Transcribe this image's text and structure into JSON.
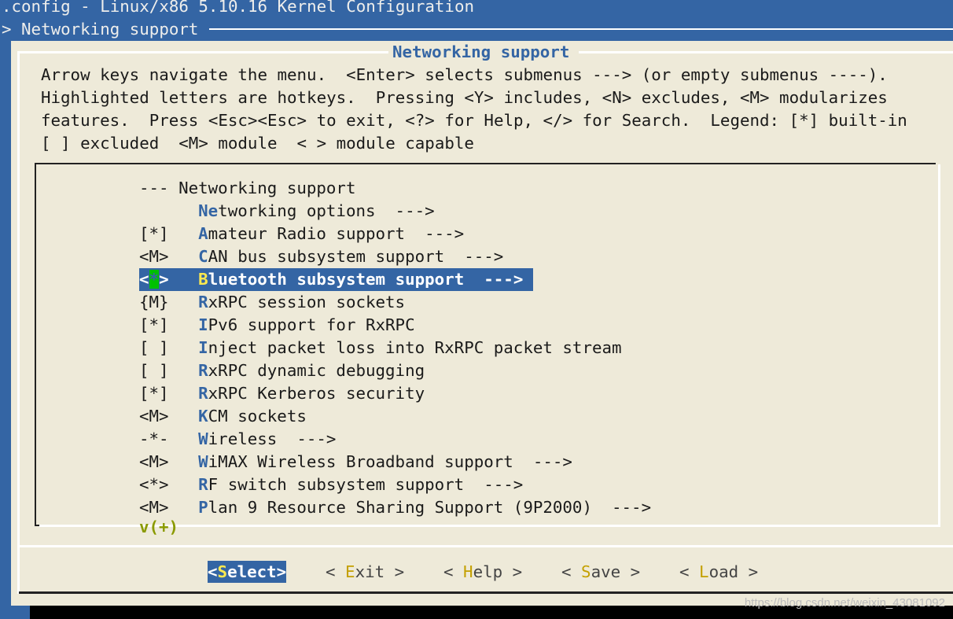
{
  "title_bar": {
    "text": ".config - Linux/x86 5.10.16 Kernel Configuration"
  },
  "breadcrumb": {
    "text": "> Networking support"
  },
  "dialog": {
    "title": "Networking support",
    "help_lines": [
      "Arrow keys navigate the menu.  <Enter> selects submenus ---> (or empty submenus ----).",
      "Highlighted letters are hotkeys.  Pressing <Y> includes, <N> excludes, <M> modularizes",
      "features.  Press <Esc><Esc> to exit, <?> for Help, </> for Search.  Legend: [*] built-in",
      "[ ] excluded  <M> module  < > module capable"
    ]
  },
  "menu": {
    "items": [
      {
        "state": "---",
        "hotkey": "",
        "rest": "Networking support",
        "selected": false
      },
      {
        "state": "   ",
        "hotkey": "Ne",
        "rest": "tworking options  --->",
        "selected": false
      },
      {
        "state": "[*]",
        "hotkey": "A",
        "rest": "mateur Radio support  --->",
        "selected": false
      },
      {
        "state": "<M>",
        "hotkey": "C",
        "rest": "AN bus subsystem support  --->",
        "selected": false
      },
      {
        "state": "<*>",
        "hotkey": "B",
        "rest": "luetooth subsystem support  --->",
        "selected": true
      },
      {
        "state": "{M}",
        "hotkey": "R",
        "rest": "xRPC session sockets",
        "selected": false
      },
      {
        "state": "[*]",
        "hotkey": "I",
        "rest": "Pv6 support for RxRPC",
        "selected": false
      },
      {
        "state": "[ ]",
        "hotkey": "I",
        "rest": "nject packet loss into RxRPC packet stream",
        "selected": false
      },
      {
        "state": "[ ]",
        "hotkey": "R",
        "rest": "xRPC dynamic debugging",
        "selected": false
      },
      {
        "state": "[*]",
        "hotkey": "R",
        "rest": "xRPC Kerberos security",
        "selected": false
      },
      {
        "state": "<M>",
        "hotkey": "K",
        "rest": "CM sockets",
        "selected": false
      },
      {
        "state": "-*-",
        "hotkey": "W",
        "rest": "ireless  --->",
        "selected": false
      },
      {
        "state": "<M>",
        "hotkey": "W",
        "rest": "iMAX Wireless Broadband support  --->",
        "selected": false
      },
      {
        "state": "<*>",
        "hotkey": "R",
        "rest": "F switch subsystem support  --->",
        "selected": false
      },
      {
        "state": "<M>",
        "hotkey": "P",
        "rest": "lan 9 Resource Sharing Support (9P2000)  --->",
        "selected": false
      }
    ],
    "more_indicator": "v(+)"
  },
  "buttons": [
    {
      "pre": "<",
      "hotkey": "S",
      "rest": "elect",
      "post": ">",
      "active": true
    },
    {
      "pre": "< ",
      "hotkey": "E",
      "rest": "xit",
      "post": " >",
      "active": false
    },
    {
      "pre": "< ",
      "hotkey": "H",
      "rest": "elp",
      "post": " >",
      "active": false
    },
    {
      "pre": "< ",
      "hotkey": "S",
      "rest": "ave",
      "post": " >",
      "active": false
    },
    {
      "pre": "< ",
      "hotkey": "L",
      "rest": "oad",
      "post": " >",
      "active": false
    }
  ],
  "watermark": "https://blog.csdn.net/weixin_43081092",
  "colors": {
    "terminal_blue": "#3465a4",
    "dialog_bg": "#eeead9",
    "hotkey_yellow": "#fce94f",
    "cursor_green": "#00c000",
    "button_hotkey": "#c4a000"
  }
}
